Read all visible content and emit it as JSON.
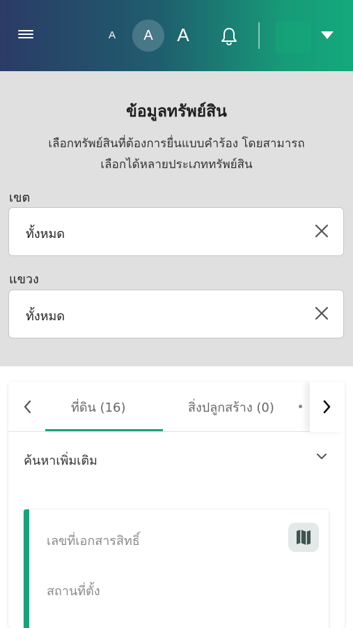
{
  "header": {
    "font_small": "A",
    "font_medium": "A",
    "font_large": "A"
  },
  "filter": {
    "title": "ข้อมูลทรัพย์สิน",
    "subtitle_line1": "เลือกทรัพย์สินที่ต้องการยื่นแบบคำร้อง โดยสามารถ",
    "subtitle_line2": "เลือกได้หลายประเภททรัพย์สิน",
    "district_label": "เขต",
    "district_value": "ทั้งหมด",
    "subdistrict_label": "แขวง",
    "subdistrict_value": "ทั้งหมด"
  },
  "tabs": {
    "land": "ที่ดิน (16)",
    "building": "สิ่งปลูกสร้าง (0)"
  },
  "search": {
    "more_label": "ค้นหาเพิ่มเติม"
  },
  "result": {
    "doc_number_label": "เลขที่เอกสารสิทธิ์",
    "location_label": "สถานที่ตั้ง"
  },
  "colors": {
    "accent": "#1aa37a",
    "header_start": "#2b3b66",
    "header_end": "#14a97c",
    "panel_bg": "#e0e0e0"
  }
}
